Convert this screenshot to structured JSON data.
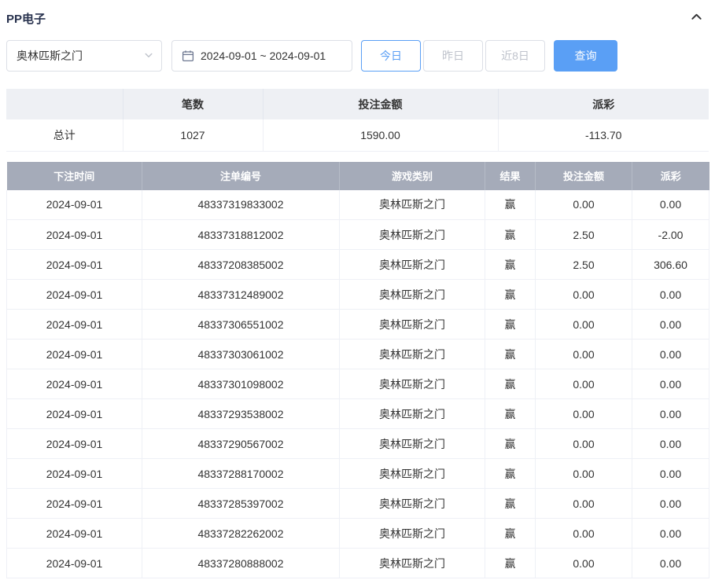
{
  "panel": {
    "title": "PP电子",
    "collapse_icon": "chevron-up-icon"
  },
  "filters": {
    "game_select": {
      "value": "奥林匹斯之门",
      "caret_icon": "chevron-down-icon"
    },
    "date_range": {
      "value": "2024-09-01 ~ 2024-09-01",
      "icon": "calendar-icon"
    },
    "quick_buttons": [
      {
        "label": "今日",
        "active": true
      },
      {
        "label": "昨日",
        "active": false
      },
      {
        "label": "近8日",
        "active": false
      }
    ],
    "search_label": "查询"
  },
  "summary": {
    "headers": [
      "",
      "笔数",
      "投注金额",
      "派彩"
    ],
    "row": {
      "label": "总计",
      "count": "1027",
      "bet_amount": "1590.00",
      "payout": "-113.70"
    }
  },
  "table": {
    "headers": [
      "下注时间",
      "注单编号",
      "游戏类别",
      "结果",
      "投注金额",
      "派彩"
    ],
    "column_keys": [
      "date",
      "order-id",
      "game-type",
      "result",
      "bet-amount",
      "payout"
    ],
    "rows": [
      [
        "2024-09-01",
        "48337319833002",
        "奥林匹斯之门",
        "赢",
        "0.00",
        "0.00"
      ],
      [
        "2024-09-01",
        "48337318812002",
        "奥林匹斯之门",
        "赢",
        "2.50",
        "-2.00"
      ],
      [
        "2024-09-01",
        "48337208385002",
        "奥林匹斯之门",
        "赢",
        "2.50",
        "306.60"
      ],
      [
        "2024-09-01",
        "48337312489002",
        "奥林匹斯之门",
        "赢",
        "0.00",
        "0.00"
      ],
      [
        "2024-09-01",
        "48337306551002",
        "奥林匹斯之门",
        "赢",
        "0.00",
        "0.00"
      ],
      [
        "2024-09-01",
        "48337303061002",
        "奥林匹斯之门",
        "赢",
        "0.00",
        "0.00"
      ],
      [
        "2024-09-01",
        "48337301098002",
        "奥林匹斯之门",
        "赢",
        "0.00",
        "0.00"
      ],
      [
        "2024-09-01",
        "48337293538002",
        "奥林匹斯之门",
        "赢",
        "0.00",
        "0.00"
      ],
      [
        "2024-09-01",
        "48337290567002",
        "奥林匹斯之门",
        "赢",
        "0.00",
        "0.00"
      ],
      [
        "2024-09-01",
        "48337288170002",
        "奥林匹斯之门",
        "赢",
        "0.00",
        "0.00"
      ],
      [
        "2024-09-01",
        "48337285397002",
        "奥林匹斯之门",
        "赢",
        "0.00",
        "0.00"
      ],
      [
        "2024-09-01",
        "48337282262002",
        "奥林匹斯之门",
        "赢",
        "0.00",
        "0.00"
      ],
      [
        "2024-09-01",
        "48337280888002",
        "奥林匹斯之门",
        "赢",
        "0.00",
        "0.00"
      ]
    ]
  },
  "colors": {
    "accent": "#5a9ff5",
    "negative": "#f25f5f",
    "table_header_bg": "#a5abb9",
    "summary_header_bg": "#eef0f4",
    "title_color": "#28324e"
  }
}
